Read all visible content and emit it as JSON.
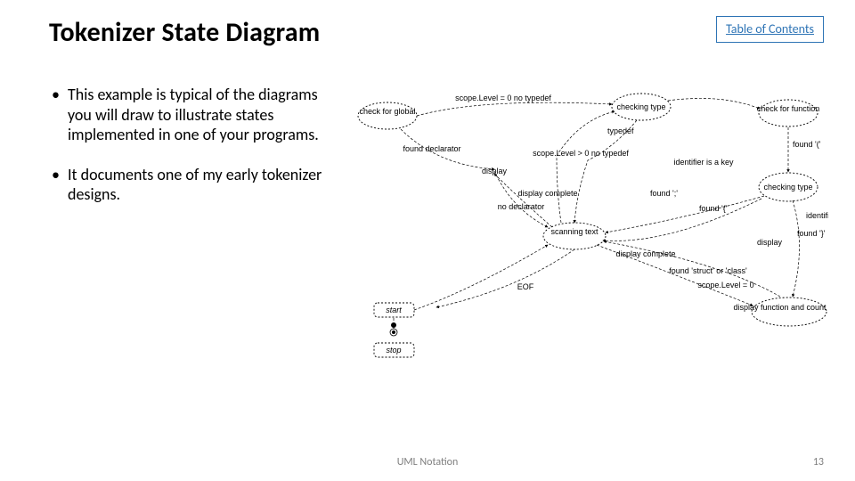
{
  "title": "Tokenizer State Diagram",
  "toc_label": "Table of Contents",
  "bullets": [
    "This example is typical of the diagrams you will draw to illustrate states implemented in one of your programs.",
    "It documents one of my early tokenizer designs."
  ],
  "footer": {
    "center": "UML Notation",
    "page": "13"
  },
  "diagram": {
    "states": {
      "check_global": "check for global",
      "checking_type_l": "checking type",
      "check_function": "check for function",
      "checking_type_r": "checking type",
      "scanning_text": "scanning text",
      "display_fn_lines": "display function and count lines",
      "start": "start",
      "stop": "stop"
    },
    "labels": {
      "scope0": "scope.Level = 0 no typedef",
      "scopeg0": "scope.Level > 0 no typedef",
      "typedef": "typedef",
      "found_decl": "found declarator",
      "no_decl": "no declarator",
      "display": "display",
      "display_complete1": "display complete",
      "display_complete2": "display complete",
      "found_semi": "found ';'",
      "found_paren": "found '('",
      "found_lbrace": "found '{'",
      "found_id": "found '}'",
      "ident_key": "identifier is a key",
      "ident_notkey": "identifier is not a key",
      "found_struct": "found 'struct' or 'class'",
      "scope0_b": "scope.Level = 0",
      "display_r": "display",
      "eof": "EOF"
    }
  }
}
